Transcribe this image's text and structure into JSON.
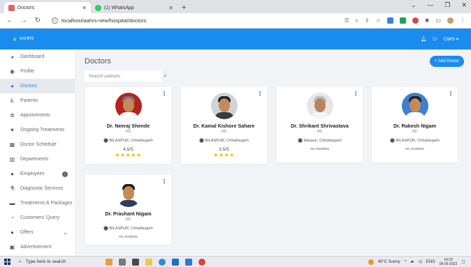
{
  "browser": {
    "tabs": [
      {
        "title": "Doctors",
        "favicon_color": "#e06666",
        "active": true
      },
      {
        "title": "(1) WhatsApp",
        "favicon_color": "#25d366",
        "active": false
      }
    ],
    "new_tab": "+",
    "url": "localhost/aahrs-new/hospital/doctors"
  },
  "app": {
    "logo_text": "AAHRS",
    "user_label": "CIMS",
    "accent": "#1a8cf0"
  },
  "sidebar": {
    "items": [
      {
        "label": "Dashboard",
        "icon": "palette-icon"
      },
      {
        "label": "Profile",
        "icon": "user-circle-icon"
      },
      {
        "label": "Doctors",
        "icon": "user-icon",
        "active": true
      },
      {
        "label": "Patients",
        "icon": "accessible-icon"
      },
      {
        "label": "Appointments",
        "icon": "list-icon"
      },
      {
        "label": "Ongoing Treatments",
        "icon": "heart-icon"
      },
      {
        "label": "Doctor Schedule",
        "icon": "calendar-icon"
      },
      {
        "label": "Departments",
        "icon": "building-icon"
      },
      {
        "label": "Employees",
        "icon": "user-icon"
      },
      {
        "label": "Diagnostic Services",
        "icon": "flask-icon"
      },
      {
        "label": "Treatments & Packages",
        "icon": "bed-icon"
      },
      {
        "label": "Customers' Query",
        "icon": "chat-icon"
      },
      {
        "label": "Offers",
        "icon": "user-icon"
      },
      {
        "label": "Advertisement",
        "icon": "image-icon"
      }
    ]
  },
  "main": {
    "title": "Doctors",
    "add_button": "+ Add Doctor",
    "search_placeholder": "Search patinets"
  },
  "doctors": [
    {
      "name": "Dr. Neeraj Shende",
      "degree": "MS",
      "location": "BILASPUR, Chhattisgarh",
      "rating": "4.5/5",
      "stars": "★★★★★",
      "reviews": "",
      "bg": "#b3241f",
      "body": "#ffffff"
    },
    {
      "name": "Dr. Kamal Kishore Sahare",
      "degree": "MD",
      "location": "BILASPUR, Chhattisgarh",
      "rating": "3.5/5",
      "stars": "★★★★",
      "reviews": "",
      "bg": "#cfd3d8",
      "body": "#3c3c3c"
    },
    {
      "name": "Dr. Shrikant Shrivastava",
      "degree": "MS",
      "location": "bilaspur, Chhattisgarh",
      "rating": "",
      "stars": "",
      "reviews": "no reviews",
      "bg": "#e6e6e6",
      "body": "#f4f4f4"
    },
    {
      "name": "Dr. Rakesh Nigam",
      "degree": "MD",
      "location": "BILASPUR, Chhattisgarh",
      "rating": "",
      "stars": "",
      "reviews": "no reviews",
      "bg": "#3d7fd0",
      "body": "#ffffff"
    },
    {
      "name": "Dr. Prashant Nigam",
      "degree": "MS",
      "location": "BILASPUR, Chhattisgarh",
      "rating": "",
      "stars": "",
      "reviews": "no reviews",
      "bg": "#ffffff",
      "body": "#2c3e62"
    }
  ],
  "taskbar": {
    "search_placeholder": "Type here to search",
    "weather": "40°C  Sunny",
    "lang": "ENG",
    "time": "14:23",
    "date": "09-05-2023"
  }
}
